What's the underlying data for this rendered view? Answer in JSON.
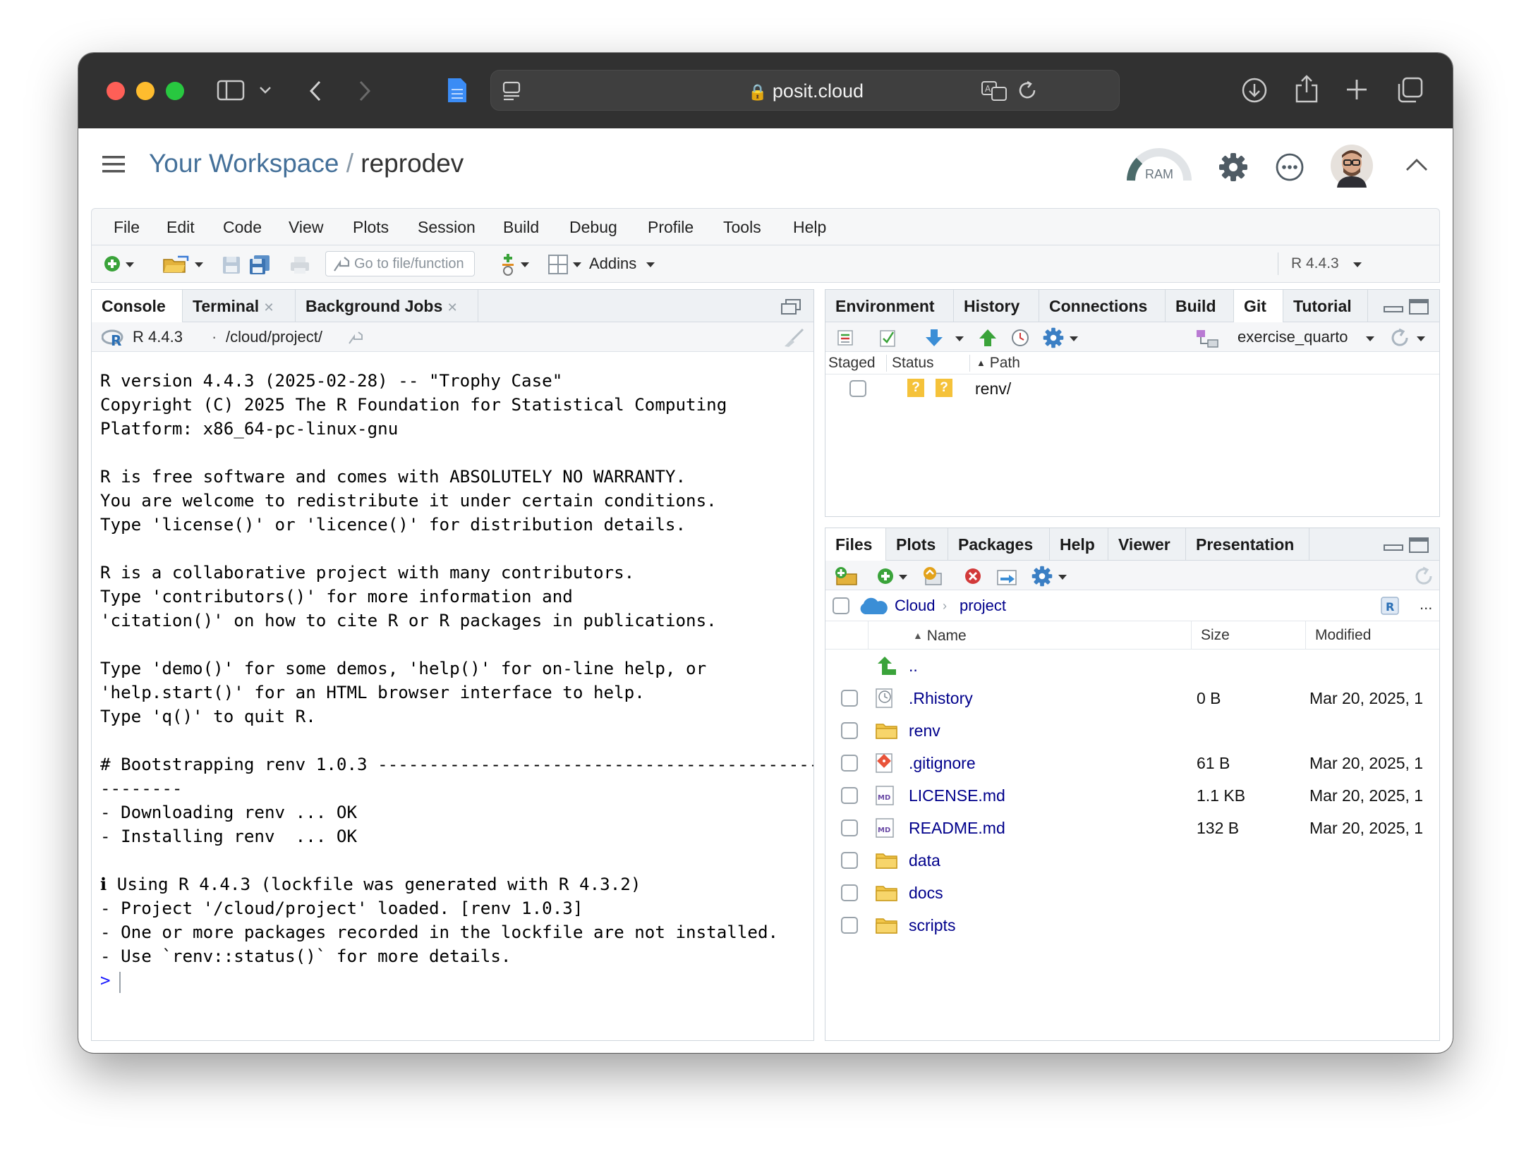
{
  "browser": {
    "url": "posit.cloud"
  },
  "header": {
    "workspace": "Your Workspace",
    "separator": "/",
    "project": "reprodev",
    "ram_label": "RAM"
  },
  "menu": [
    "File",
    "Edit",
    "Code",
    "View",
    "Plots",
    "Session",
    "Build",
    "Debug",
    "Profile",
    "Tools",
    "Help"
  ],
  "toolbar": {
    "goto_placeholder": "Go to file/function",
    "addins": "Addins",
    "r_version": "R 4.4.3"
  },
  "console_pane": {
    "tabs": [
      "Console",
      "Terminal",
      "Background Jobs"
    ],
    "r_version": "R 4.4.3",
    "dot": "·",
    "path": "/cloud/project/",
    "lines": [
      "R version 4.4.3 (2025-02-28) -- \"Trophy Case\"",
      "Copyright (C) 2025 The R Foundation for Statistical Computing",
      "Platform: x86_64-pc-linux-gnu",
      "",
      "R is free software and comes with ABSOLUTELY NO WARRANTY.",
      "You are welcome to redistribute it under certain conditions.",
      "Type 'license()' or 'licence()' for distribution details.",
      "",
      "R is a collaborative project with many contributors.",
      "Type 'contributors()' for more information and",
      "'citation()' on how to cite R or R packages in publications.",
      "",
      "Type 'demo()' for some demos, 'help()' for on-line help, or",
      "'help.start()' for an HTML browser interface to help.",
      "Type 'q()' to quit R.",
      "",
      "# Bootstrapping renv 1.0.3 -------------------------------------------",
      "--------",
      "- Downloading renv ... OK",
      "- Installing renv  ... OK",
      "",
      "ℹ Using R 4.4.3 (lockfile was generated with R 4.3.2)",
      "- Project '/cloud/project' loaded. [renv 1.0.3]",
      "- One or more packages recorded in the lockfile are not installed.",
      "- Use `renv::status()` for more details."
    ],
    "prompt": ">"
  },
  "git_pane": {
    "tabs": [
      "Environment",
      "History",
      "Connections",
      "Build",
      "Git",
      "Tutorial"
    ],
    "branch": "exercise_quarto",
    "columns": [
      "Staged",
      "Status",
      "Path"
    ],
    "rows": [
      {
        "status": "?",
        "status2": "?",
        "path": "renv/"
      }
    ]
  },
  "files_pane": {
    "tabs": [
      "Files",
      "Plots",
      "Packages",
      "Help",
      "Viewer",
      "Presentation"
    ],
    "breadcrumb": [
      "Cloud",
      "project"
    ],
    "more": "...",
    "columns": [
      "Name",
      "Size",
      "Modified"
    ],
    "parent": "..",
    "rows": [
      {
        "name": ".Rhistory",
        "size": "0 B",
        "modified": "Mar 20, 2025, 1",
        "icon": "history-file-icon"
      },
      {
        "name": "renv",
        "size": "",
        "modified": "",
        "icon": "folder-icon"
      },
      {
        "name": ".gitignore",
        "size": "61 B",
        "modified": "Mar 20, 2025, 1",
        "icon": "git-file-icon"
      },
      {
        "name": "LICENSE.md",
        "size": "1.1 KB",
        "modified": "Mar 20, 2025, 1",
        "icon": "markdown-file-icon"
      },
      {
        "name": "README.md",
        "size": "132 B",
        "modified": "Mar 20, 2025, 1",
        "icon": "markdown-file-icon"
      },
      {
        "name": "data",
        "size": "",
        "modified": "",
        "icon": "folder-icon"
      },
      {
        "name": "docs",
        "size": "",
        "modified": "",
        "icon": "folder-icon"
      },
      {
        "name": "scripts",
        "size": "",
        "modified": "",
        "icon": "folder-icon"
      }
    ]
  },
  "colors": {
    "link": "#00008b",
    "workspace": "#447099",
    "safari_bar": "#313131"
  }
}
